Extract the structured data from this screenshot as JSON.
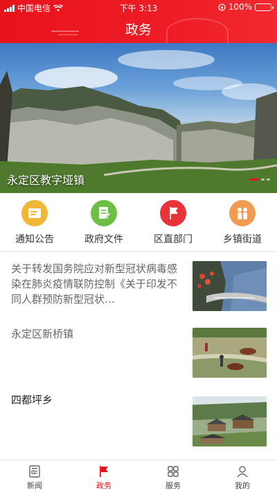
{
  "status_bar": {
    "carrier": "中国电信",
    "time": "下午 3:13",
    "battery": "100%",
    "battery_level": 1.0
  },
  "header": {
    "title": "政务"
  },
  "banner": {
    "caption": "永定区教字垭镇",
    "slide_count": 3,
    "active_slide": 1
  },
  "quick_nav": [
    {
      "label": "通知公告",
      "icon": "notice-icon",
      "color": "#f2b736"
    },
    {
      "label": "政府文件",
      "icon": "document-icon",
      "color": "#6cbe45"
    },
    {
      "label": "区直部门",
      "icon": "flag-icon",
      "color": "#e8333a"
    },
    {
      "label": "乡镇街道",
      "icon": "people-icon",
      "color": "#f29c53"
    }
  ],
  "news": [
    {
      "title": "关于转发国务院应对新型冠状病毒感染在肺炎疫情联防控制《关于印发不同人群预防新型冠状…",
      "thumb": "cliff-road-image"
    },
    {
      "title": "永定区新桥镇",
      "thumb": "rice-field-image"
    },
    {
      "title": "四都坪乡",
      "thumb": "village-image"
    }
  ],
  "tabs": [
    {
      "label": "新闻",
      "icon": "news-icon",
      "active": false
    },
    {
      "label": "政务",
      "icon": "government-flag-icon",
      "active": true
    },
    {
      "label": "服务",
      "icon": "grid-icon",
      "active": false
    },
    {
      "label": "我的",
      "icon": "user-icon",
      "active": false
    }
  ],
  "colors": {
    "brand": "#e8141c",
    "tab_inactive": "#444444"
  }
}
